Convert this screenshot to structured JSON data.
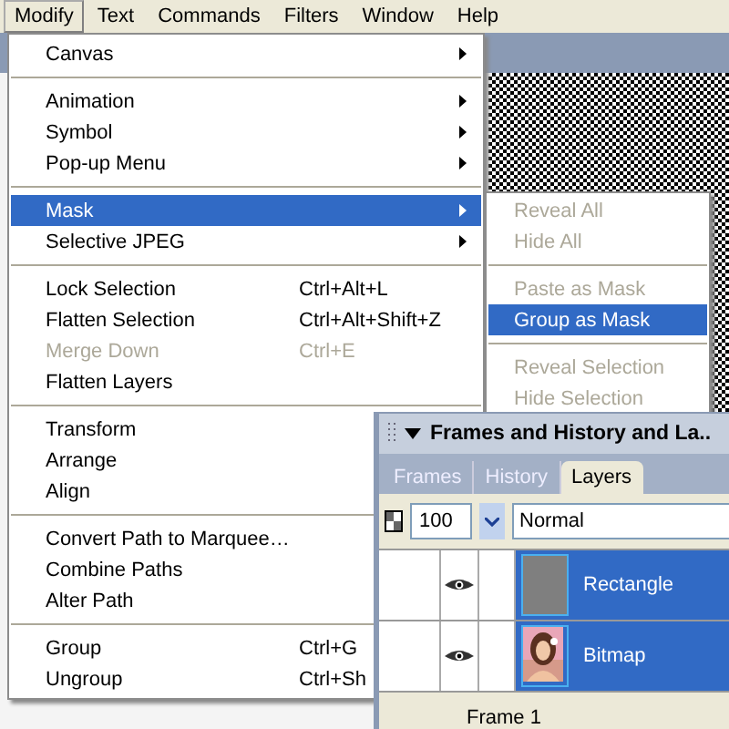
{
  "menubar": [
    {
      "label": "Modify",
      "selected": true
    },
    {
      "label": "Text",
      "selected": false
    },
    {
      "label": "Commands",
      "selected": false
    },
    {
      "label": "Filters",
      "selected": false
    },
    {
      "label": "Window",
      "selected": false
    },
    {
      "label": "Help",
      "selected": false
    }
  ],
  "menu": [
    {
      "kind": "item",
      "label": "Canvas",
      "disabled": false,
      "selected": false,
      "submenu": true
    },
    {
      "kind": "separator"
    },
    {
      "kind": "item",
      "label": "Animation",
      "disabled": false,
      "selected": false,
      "submenu": true
    },
    {
      "kind": "item",
      "label": "Symbol",
      "disabled": false,
      "selected": false,
      "submenu": true
    },
    {
      "kind": "item",
      "label": "Pop-up Menu",
      "disabled": false,
      "selected": false,
      "submenu": true
    },
    {
      "kind": "separator"
    },
    {
      "kind": "item",
      "label": "Mask",
      "disabled": false,
      "selected": true,
      "submenu": true
    },
    {
      "kind": "item",
      "label": "Selective JPEG",
      "disabled": false,
      "selected": false,
      "submenu": true
    },
    {
      "kind": "separator"
    },
    {
      "kind": "item",
      "label": "Lock Selection",
      "shortcut": "Ctrl+Alt+L",
      "disabled": false,
      "selected": false,
      "submenu": false
    },
    {
      "kind": "item",
      "label": "Flatten Selection",
      "shortcut": "Ctrl+Alt+Shift+Z",
      "disabled": false,
      "selected": false,
      "submenu": false
    },
    {
      "kind": "item",
      "label": "Merge Down",
      "shortcut": "Ctrl+E",
      "disabled": true,
      "selected": false,
      "submenu": false
    },
    {
      "kind": "item",
      "label": "Flatten Layers",
      "disabled": false,
      "selected": false,
      "submenu": false
    },
    {
      "kind": "separator"
    },
    {
      "kind": "item",
      "label": "Transform",
      "disabled": false,
      "selected": false,
      "submenu": false
    },
    {
      "kind": "item",
      "label": "Arrange",
      "disabled": false,
      "selected": false,
      "submenu": false
    },
    {
      "kind": "item",
      "label": "Align",
      "disabled": false,
      "selected": false,
      "submenu": false
    },
    {
      "kind": "separator"
    },
    {
      "kind": "item",
      "label": "Convert Path to Marquee…",
      "disabled": false,
      "selected": false,
      "submenu": false
    },
    {
      "kind": "item",
      "label": "Combine Paths",
      "disabled": false,
      "selected": false,
      "submenu": false
    },
    {
      "kind": "item",
      "label": "Alter Path",
      "disabled": false,
      "selected": false,
      "submenu": false
    },
    {
      "kind": "separator"
    },
    {
      "kind": "item",
      "label": "Group",
      "shortcut": "Ctrl+G",
      "disabled": false,
      "selected": false,
      "submenu": false
    },
    {
      "kind": "item",
      "label": "Ungroup",
      "shortcut": "Ctrl+Sh",
      "disabled": false,
      "selected": false,
      "submenu": false
    }
  ],
  "submenu": [
    {
      "kind": "item",
      "label": "Reveal All",
      "disabled": true,
      "selected": false
    },
    {
      "kind": "item",
      "label": "Hide All",
      "disabled": true,
      "selected": false
    },
    {
      "kind": "separator"
    },
    {
      "kind": "item",
      "label": "Paste as Mask",
      "disabled": true,
      "selected": false
    },
    {
      "kind": "item",
      "label": "Group as Mask",
      "disabled": false,
      "selected": true
    },
    {
      "kind": "separator"
    },
    {
      "kind": "item",
      "label": "Reveal Selection",
      "disabled": true,
      "selected": false
    },
    {
      "kind": "item",
      "label": "Hide Selection",
      "disabled": true,
      "selected": false
    }
  ],
  "panel": {
    "title": "Frames and History and La..",
    "tabs": [
      {
        "label": "Frames",
        "selected": false
      },
      {
        "label": "History",
        "selected": false
      },
      {
        "label": "Layers",
        "selected": true
      }
    ],
    "opacity": "100",
    "blend_mode": "Normal",
    "layers": [
      {
        "name": "Rectangle",
        "selected": true,
        "visible": true,
        "kind": "shape"
      },
      {
        "name": "Bitmap",
        "selected": true,
        "visible": true,
        "kind": "picture"
      }
    ],
    "status": "Frame 1"
  }
}
